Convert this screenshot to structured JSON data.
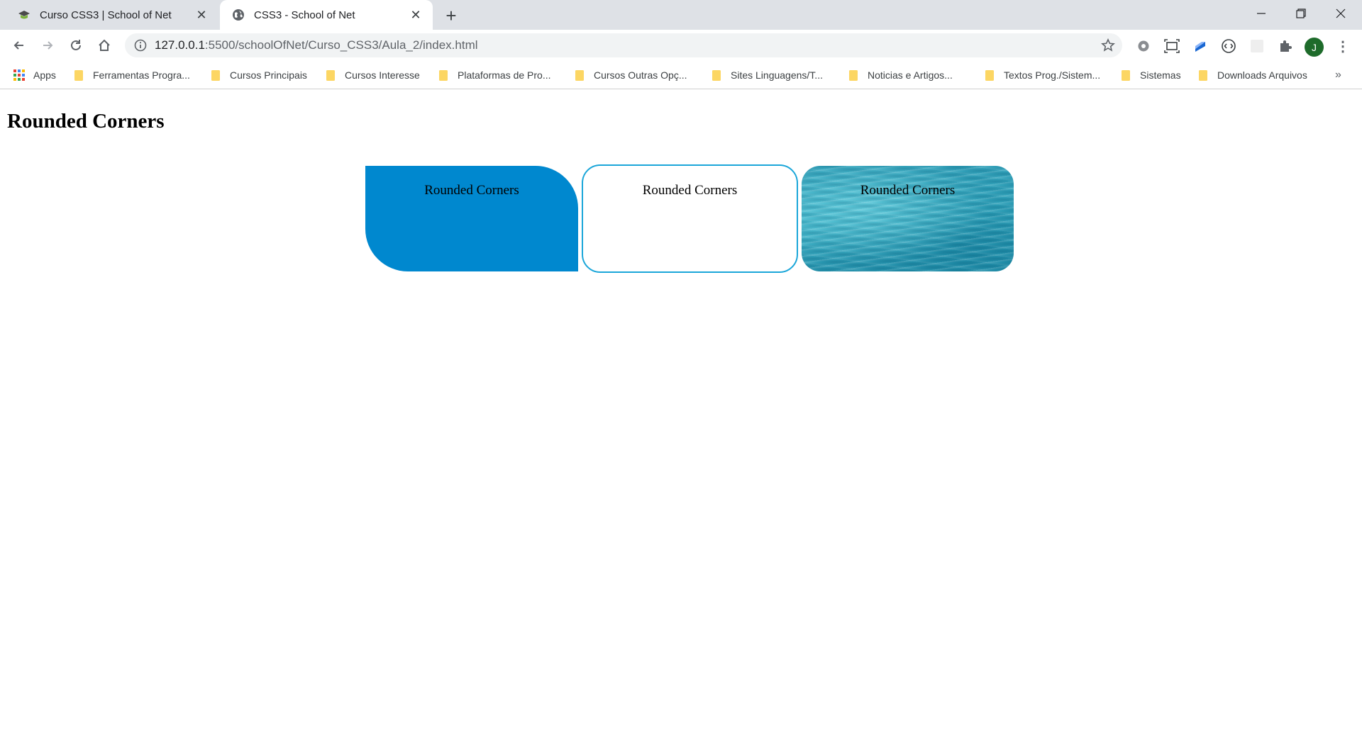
{
  "browser": {
    "tabs": [
      {
        "title": "Curso CSS3 | School of Net",
        "active": false,
        "icon": "school-of-net-icon"
      },
      {
        "title": "CSS3 - School of Net",
        "active": true,
        "icon": "globe-icon"
      }
    ],
    "new_tab": "+",
    "url_host": "127.0.0.1",
    "url_rest": ":5500/schoolOfNet/Curso_CSS3/Aula_2/index.html",
    "avatar_letter": "J",
    "bookmarks": [
      "Apps",
      "Ferramentas Progra...",
      "Cursos Principais",
      "Cursos Interesse",
      "Plataformas de Pro...",
      "Cursos Outras Opç...",
      "Sites Linguagens/T...",
      "Noticias e Artigos...",
      "Textos Prog./Sistem...",
      "Sistemas",
      "Downloads Arquivos"
    ],
    "bookmarks_more": "»"
  },
  "page": {
    "heading": "Rounded Corners",
    "boxes": [
      {
        "label": "Rounded Corners",
        "style": "solid-blue",
        "color": "#0088cf"
      },
      {
        "label": "Rounded Corners",
        "style": "bordered",
        "color": "#1aa6d9"
      },
      {
        "label": "Rounded Corners",
        "style": "water-image",
        "color": "#2aa3bb"
      }
    ]
  },
  "colors": {
    "tabstrip": "#dee1e6",
    "omnibox": "#f1f3f4",
    "avatar": "#1e6b2b",
    "folder": "#fcd663"
  }
}
